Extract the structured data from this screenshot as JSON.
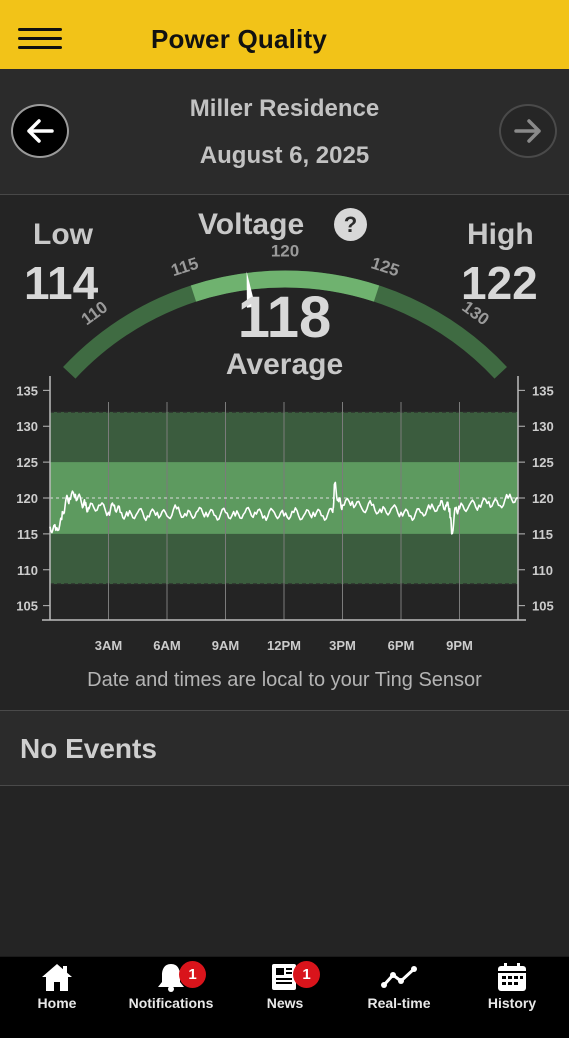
{
  "header": {
    "title": "Power Quality",
    "menu_icon": "hamburger-menu-icon",
    "background": "#f2c318"
  },
  "date_nav": {
    "location": "Miller Residence",
    "date": "August 6, 2025",
    "prev_icon": "arrow-left-icon",
    "next_icon": "arrow-right-icon"
  },
  "voltage": {
    "title": "Voltage",
    "help": "?",
    "low_label": "Low",
    "low_value": "114",
    "high_label": "High",
    "high_value": "122",
    "average_value": "118",
    "average_label": "Average",
    "gauge_ticks": [
      "110",
      "115",
      "120",
      "125",
      "130"
    ],
    "gauge_range": [
      107,
      133
    ],
    "normal_band": [
      115,
      125
    ],
    "needle": 118,
    "colors": {
      "normal": "#6fb26f",
      "outer": "#3f6b42"
    }
  },
  "chart_data": {
    "type": "line",
    "xlabel": "",
    "ylabel": "",
    "ylim": [
      103,
      137
    ],
    "yticks": [
      105,
      110,
      115,
      120,
      125,
      130,
      135
    ],
    "xticks": [
      "3AM",
      "6AM",
      "9AM",
      "12PM",
      "3PM",
      "6PM",
      "9PM"
    ],
    "x_hours": [
      3,
      6,
      9,
      12,
      15,
      18,
      21
    ],
    "x_range": [
      0,
      24
    ],
    "bands": [
      {
        "from": 108,
        "to": 132,
        "color": "#3b5c3e"
      },
      {
        "from": 115,
        "to": 125,
        "color": "#5d9a5f"
      }
    ],
    "reference_line": 120,
    "line_color": "#ffffff",
    "series": [
      {
        "x": [
          0,
          0.3,
          0.6,
          0.8,
          1.0,
          1.3,
          1.6,
          1.8,
          2.0,
          2.5,
          3.0,
          3.3,
          3.6,
          4.0,
          4.5,
          5.0,
          5.5,
          6.0,
          6.5,
          7.0,
          7.5,
          8.0,
          8.5,
          9.0,
          9.5,
          10.0,
          10.5,
          11.0,
          11.5,
          12.0,
          12.5,
          13.0,
          13.5,
          14.0,
          14.5,
          14.6,
          14.8,
          15.0,
          15.5,
          16.0,
          16.5,
          17.0,
          17.5,
          18.0,
          18.5,
          19.0,
          19.5,
          20.0,
          20.3,
          20.5,
          20.6,
          20.8,
          21.0,
          21.5,
          22.0,
          22.5,
          23.0,
          23.5,
          24.0
        ],
        "y": [
          116,
          115.5,
          117,
          119.5,
          120,
          120.5,
          119.5,
          119,
          118.5,
          119,
          118,
          119,
          118,
          117.5,
          118,
          117.5,
          118,
          117.5,
          118.5,
          117.5,
          118,
          118,
          117.5,
          118,
          117.5,
          118,
          118,
          117.5,
          118,
          117.5,
          118,
          117.5,
          118,
          117.5,
          118,
          122,
          119.5,
          119,
          119.5,
          118.5,
          119,
          118,
          118.5,
          118,
          117.5,
          118,
          118.5,
          119,
          119,
          118.5,
          115,
          118.5,
          118.5,
          119,
          119,
          119.5,
          119,
          120,
          120
        ]
      }
    ]
  },
  "chart_note": "Date and times are local to your Ting Sensor",
  "events": {
    "label": "No Events"
  },
  "tabs": [
    {
      "label": "Home",
      "icon": "home-icon",
      "badge": ""
    },
    {
      "label": "Notifications",
      "icon": "bell-icon",
      "badge": "1"
    },
    {
      "label": "News",
      "icon": "newspaper-icon",
      "badge": "1"
    },
    {
      "label": "Real-time",
      "icon": "line-chart-icon",
      "badge": ""
    },
    {
      "label": "History",
      "icon": "calendar-icon",
      "badge": ""
    }
  ]
}
